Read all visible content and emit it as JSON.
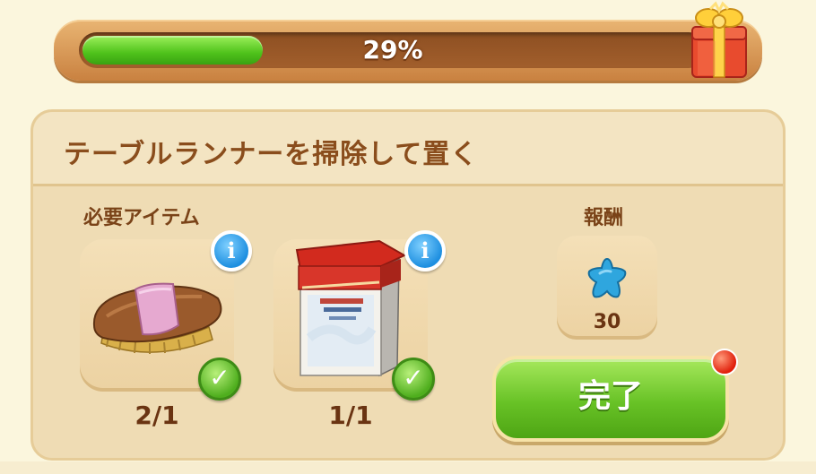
{
  "progress": {
    "percent_label": "29%",
    "fraction": 0.29
  },
  "quest": {
    "title": "テーブルランナーを掃除して置く",
    "required_label": "必要アイテム",
    "reward_label": "報酬",
    "items": [
      {
        "name": "brush",
        "icon": "brush-icon",
        "count": "2/1",
        "info": "i",
        "check": "✓"
      },
      {
        "name": "cleaner-box",
        "icon": "cleaner-box-icon",
        "count": "1/1",
        "info": "i",
        "check": "✓"
      }
    ],
    "reward": {
      "icon": "blue-star-icon",
      "amount": "30"
    },
    "complete_label": "完了"
  },
  "colors": {
    "progress_green": "#4fc21b",
    "button_green": "#68c226",
    "title_brown": "#8a4d1c",
    "info_blue": "#1e8fe0",
    "notification_red": "#e01e0a"
  }
}
